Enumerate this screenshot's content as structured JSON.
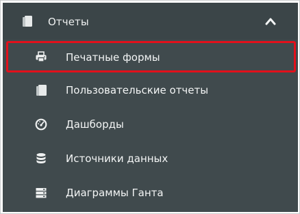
{
  "menu": {
    "section_title": "Отчеты",
    "section_icon": "report-icon",
    "collapse_icon": "chevron-up-icon",
    "items": [
      {
        "label": "Печатные формы",
        "icon": "printer-icon",
        "selected": true
      },
      {
        "label": "Пользовательские отчеты",
        "icon": "report-icon",
        "selected": false
      },
      {
        "label": "Дашборды",
        "icon": "dashboard-gauge-icon",
        "selected": false
      },
      {
        "label": "Источники данных",
        "icon": "database-icon",
        "selected": false
      },
      {
        "label": "Диаграммы Ганта",
        "icon": "server-stack-icon",
        "selected": false
      }
    ]
  },
  "colors": {
    "panel_background": "#404a4d",
    "header_background": "#3b4548",
    "text": "#f3f5f5",
    "highlight_border": "#e3101b"
  }
}
